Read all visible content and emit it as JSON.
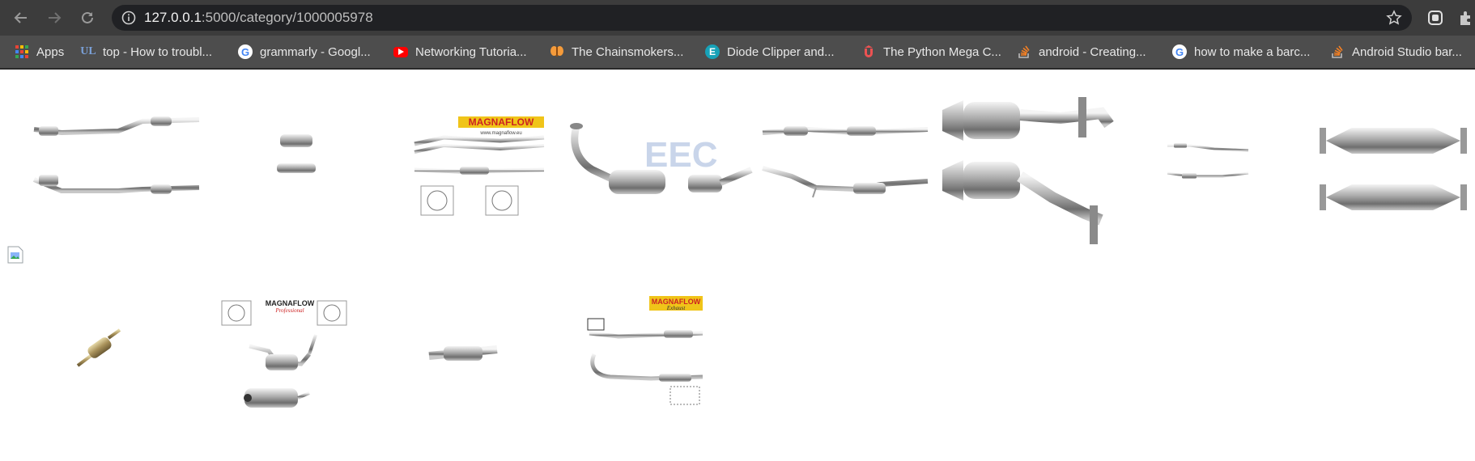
{
  "browser": {
    "url_host": "127.0.0.1",
    "url_rest": ":5000/category/1000005978",
    "icons": {
      "back": "back-arrow-icon",
      "forward": "forward-arrow-icon",
      "reload": "reload-icon",
      "info": "info-icon",
      "star": "star-icon",
      "extensions": "puzzle-icon"
    }
  },
  "bookmarks": [
    {
      "label": "Apps",
      "icon": "apps-grid-icon"
    },
    {
      "label": "top - How to troubl...",
      "icon": "ul-logo-icon"
    },
    {
      "label": "grammarly - Googl...",
      "icon": "google-icon"
    },
    {
      "label": "Networking Tutoria...",
      "icon": "youtube-icon"
    },
    {
      "label": "The Chainsmokers...",
      "icon": "butterfly-icon"
    },
    {
      "label": "Diode Clipper and...",
      "icon": "e-logo-icon"
    },
    {
      "label": "The Python Mega C...",
      "icon": "udemy-icon"
    },
    {
      "label": "android - Creating...",
      "icon": "stackoverflow-icon"
    },
    {
      "label": "how to make a barc...",
      "icon": "google-icon"
    },
    {
      "label": "Android Studio bar...",
      "icon": "stackoverflow-icon"
    }
  ],
  "products": [
    {
      "kind": "long-pipes-pair"
    },
    {
      "kind": "small-converter-pair"
    },
    {
      "kind": "magnaflow-diagram",
      "brand": "MAGNAFLOW",
      "site": "www.magnaflow.eu"
    },
    {
      "kind": "bent-pipe-converter",
      "watermark": "EEC"
    },
    {
      "kind": "long-pipes-pair"
    },
    {
      "kind": "large-converter-pair"
    },
    {
      "kind": "thin-pipes-pair"
    },
    {
      "kind": "cylinder-converter-pair"
    },
    {
      "kind": "broken-image"
    },
    {
      "kind": "single-small-converter"
    },
    {
      "kind": "magnaflow-diagram",
      "brand": "MAGNAFLOW",
      "site": "Professional"
    },
    {
      "kind": "single-pipe"
    },
    {
      "kind": "magnaflow-diagram",
      "brand": "MAGNAFLOW",
      "site": "Exhaust"
    }
  ]
}
